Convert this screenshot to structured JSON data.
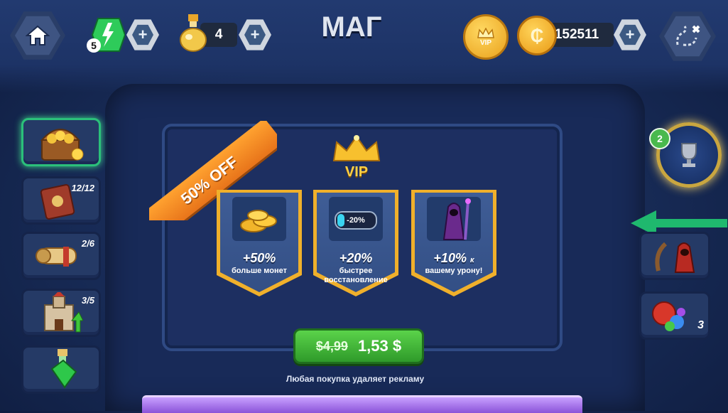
{
  "header": {
    "title": "МАГ",
    "energy_level": "5",
    "potion_count": "4",
    "vip_badge": "VIP",
    "coins": "152511"
  },
  "sidebar_left": [
    {
      "icon": "treasure-chest-icon",
      "count": ""
    },
    {
      "icon": "spell-book-icon",
      "count": "12/12"
    },
    {
      "icon": "scroll-icon",
      "count": "2/6"
    },
    {
      "icon": "castle-upgrade-icon",
      "count": "3/5"
    },
    {
      "icon": "green-potion-icon",
      "count": ""
    }
  ],
  "sidebar_right": {
    "trophy_badge": "2",
    "gems_count": "3"
  },
  "offer": {
    "discount_ribbon": "50% OFF",
    "vip_label": "VIP",
    "cards": [
      {
        "icon": "gold-coins-icon",
        "percent": "+50%",
        "desc": "больше монет"
      },
      {
        "icon": "battery-icon",
        "badge": "-20%",
        "percent": "+20%",
        "desc": "быстрее восстановление"
      },
      {
        "icon": "wizard-icon",
        "percent": "+10%",
        "desc_inline": "к",
        "desc": "вашему урону!"
      }
    ],
    "old_price": "$4,99",
    "new_price": "1,53 $",
    "note": "Любая покупка удаляет рекламу"
  },
  "colors": {
    "accent_green": "#3fbf3a",
    "ribbon_orange": "#f08a1c",
    "gold": "#f0b02b"
  }
}
